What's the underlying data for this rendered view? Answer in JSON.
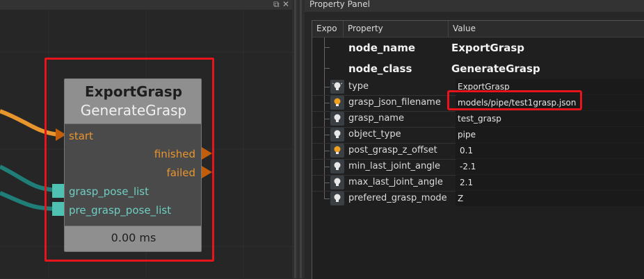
{
  "panel": {
    "title": "Property Panel",
    "columns": {
      "expose": "Expo",
      "property": "Property",
      "value": "Value"
    }
  },
  "node": {
    "name": "ExportGrasp",
    "class": "GenerateGrasp",
    "inputs_exec": [
      "start"
    ],
    "outputs_exec": [
      "finished",
      "failed"
    ],
    "inputs_data": [
      "grasp_pose_list",
      "pre_grasp_pose_list"
    ],
    "time": "0.00 ms"
  },
  "properties": {
    "header_rows": [
      {
        "name": "node_name",
        "value": "ExportGrasp"
      },
      {
        "name": "node_class",
        "value": "GenerateGrasp"
      }
    ],
    "rows": [
      {
        "name": "type",
        "value": "ExportGrasp",
        "icon": "lightbulb-off-icon"
      },
      {
        "name": "grasp_json_filename",
        "value": "models/pipe/test1grasp.json",
        "icon": "lightbulb-on-icon"
      },
      {
        "name": "grasp_name",
        "value": "test_grasp",
        "icon": "lightbulb-off-icon"
      },
      {
        "name": "object_type",
        "value": "pipe",
        "icon": "lightbulb-off-icon"
      },
      {
        "name": "post_grasp_z_offset",
        "value": "0.1",
        "icon": "lightbulb-on-icon"
      },
      {
        "name": "min_last_joint_angle",
        "value": "-2.1",
        "icon": "lightbulb-off-icon"
      },
      {
        "name": "max_last_joint_angle",
        "value": "2.1",
        "icon": "lightbulb-off-icon"
      },
      {
        "name": "prefered_grasp_mode",
        "value": "Z",
        "icon": "lightbulb-off-icon"
      }
    ]
  },
  "colors": {
    "exec_port": "#e8952e",
    "data_port": "#4fc1b3",
    "data_wire": "#1f7f78",
    "highlight": "#e8141b",
    "bulb_on": "#f0a020",
    "bulb_off": "#e8e8e8"
  }
}
